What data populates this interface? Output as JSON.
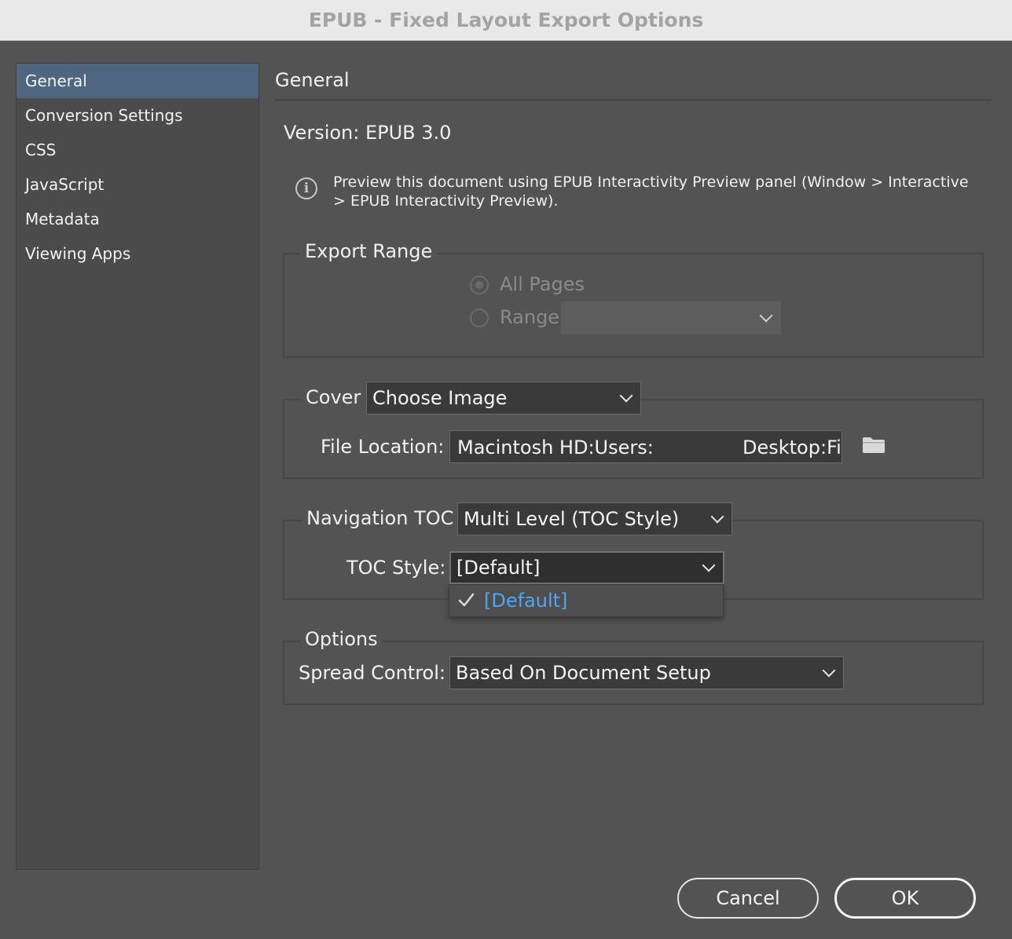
{
  "window": {
    "title": "EPUB - Fixed Layout Export Options"
  },
  "sidebar": {
    "items": [
      {
        "label": "General"
      },
      {
        "label": "Conversion Settings"
      },
      {
        "label": "CSS"
      },
      {
        "label": "JavaScript"
      },
      {
        "label": "Metadata"
      },
      {
        "label": "Viewing Apps"
      }
    ],
    "selected": "General"
  },
  "main": {
    "section_title": "General",
    "version_text": "Version: EPUB 3.0",
    "info_text": "Preview this document using EPUB Interactivity Preview panel (Window > Interactive > EPUB Interactivity Preview).",
    "icons": {
      "info": "info-icon",
      "folder": "folder-icon",
      "check": "checkmark-icon"
    },
    "export_range": {
      "legend": "Export Range",
      "all_pages_label": "All Pages",
      "range_label": "Range",
      "range_value": "",
      "selected": "All Pages"
    },
    "cover": {
      "legend": "Cover",
      "select_value": "Choose Image",
      "file_location_label": "File Location:",
      "file_location_start": "Macintosh HD:Users:",
      "file_location_end": "Desktop:Fi"
    },
    "navigation": {
      "legend": "Navigation TOC",
      "select_value": "Multi Level (TOC Style)",
      "toc_style_label": "TOC Style:",
      "toc_style_value": "[Default]",
      "menu_items": [
        {
          "label": "[Default]",
          "checked": true
        }
      ]
    },
    "options": {
      "legend": "Options",
      "spread_control_label": "Spread Control:",
      "spread_control_value": "Based On Document Setup"
    }
  },
  "buttons": {
    "cancel": "Cancel",
    "ok": "OK"
  },
  "colors": {
    "background": "#535353",
    "sidebar_selected": "#4f6680",
    "menu_highlight_text": "#4fa6f2",
    "titlebar": "#e9e9e9"
  }
}
